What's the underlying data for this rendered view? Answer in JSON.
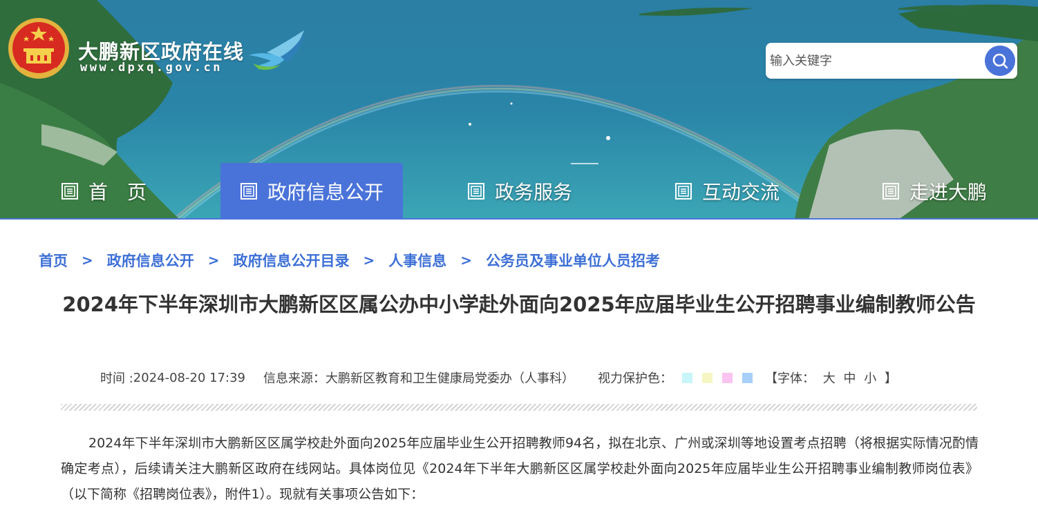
{
  "header": {
    "site_name": "大鹏新区政府在线",
    "site_url": "www.dpxq.gov.cn",
    "emblem_icon": "national-emblem-icon",
    "logo_icon": "dapeng-bird-logo-icon"
  },
  "search": {
    "placeholder": "输入关键字",
    "button_icon": "search-icon"
  },
  "nav": {
    "items": [
      {
        "label": "首　页",
        "active": false
      },
      {
        "label": "政府信息公开",
        "active": true
      },
      {
        "label": "政务服务",
        "active": false
      },
      {
        "label": "互动交流",
        "active": false
      },
      {
        "label": "走进大鹏",
        "active": false
      }
    ]
  },
  "breadcrumb": {
    "items": [
      "首页",
      "政府信息公开",
      "政府信息公开目录",
      "人事信息",
      "公务员及事业单位人员招考"
    ],
    "separator": ">"
  },
  "article": {
    "title": "2024年下半年深圳市大鹏新区区属公办中小学赴外面向2025年应届毕业生公开招聘事业编制教师公告",
    "meta": {
      "time_label": "时间 : ",
      "time": "2024-08-20 17:39",
      "source": "信息来源：大鹏新区教育和卫生健康局党委办（人事科）",
      "eye_label": "视力保护色：",
      "swatch_colors": [
        "#c8f5f8",
        "#f5f6c4",
        "#f9c4f0",
        "#a8cff7"
      ],
      "font_label": "【字体：",
      "font_large": "大",
      "font_medium": "中",
      "font_small": "小",
      "font_close": "】"
    },
    "body": "2024年下半年深圳市大鹏新区区属学校赴外面向2025年应届毕业生公开招聘教师94名，拟在北京、广州或深圳等地设置考点招聘（将根据实际情况酌情确定考点），后续请关注大鹏新区政府在线网站。具体岗位见《2024年下半年大鹏新区区属学校赴外面向2025年应届毕业生公开招聘事业编制教师岗位表》（以下简称《招聘岗位表》，附件1）。现就有关事项公告如下："
  },
  "colors": {
    "accent": "#4a73d9",
    "link": "#3d6fd6"
  }
}
